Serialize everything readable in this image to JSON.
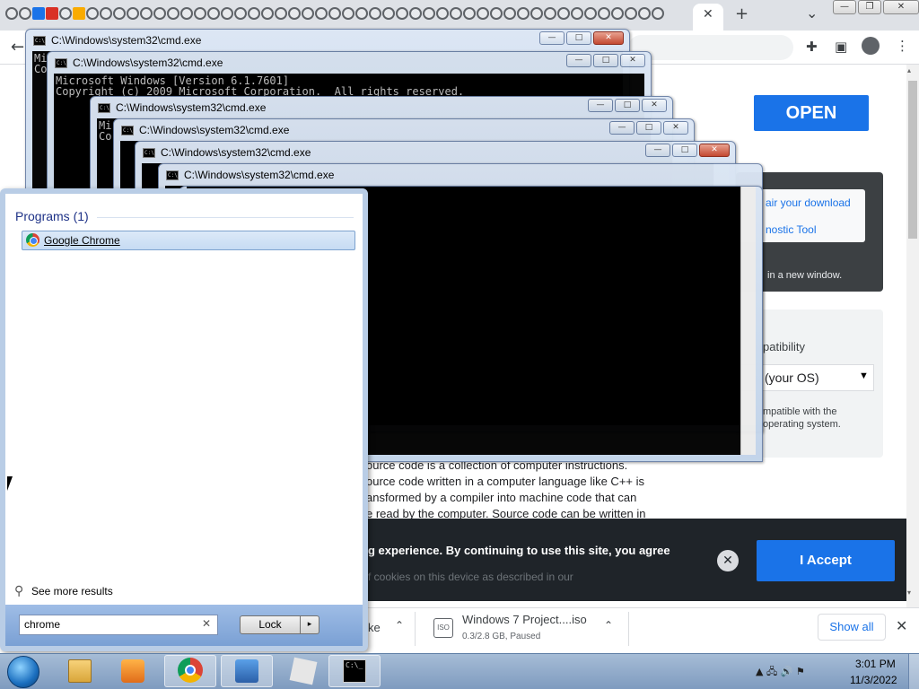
{
  "browser": {
    "new_tab_glyph": "+",
    "close_tab_glyph": "✕",
    "menu_caret": "⌄",
    "back_glyph": "←",
    "window_controls": [
      "—",
      "❐",
      "✕"
    ],
    "toolbar_icons": [
      "extensions-icon",
      "side-panel-icon",
      "profile-icon",
      "menu-icon"
    ]
  },
  "page": {
    "open_button": "OPEN",
    "repair_link": "air your download",
    "diagnostic_link": "nostic Tool",
    "new_window_text": "in a new window.",
    "compat_label": "patibility",
    "os_select_value": "(your OS)",
    "compat_note_1": "mpatible with the",
    "compat_note_2": "operating system.",
    "body_lines": [
      "ource code is a collection of computer instructions.",
      "ource code written in a computer language like C++ is",
      "ansformed by a compiler into machine code that can",
      "e read by the computer. Source code can be written in"
    ]
  },
  "cookie": {
    "text": "g experience. By continuing to use this site, you agree",
    "sub": "f cookies on this device as described in our",
    "close_glyph": "✕",
    "accept_label": "I Accept"
  },
  "downloads": {
    "prev_name": "ke",
    "item_name": "Windows 7 Project....iso",
    "item_status": "0.3/2.8 GB, Paused",
    "item_icon": "ISO",
    "show_all": "Show all",
    "close_glyph": "✕",
    "chevron": "⌃"
  },
  "cmd": {
    "title": "C:\\Windows\\system32\\cmd.exe",
    "icon_text": "C:\\",
    "line1": "Microsoft Windows [Version 6.1.7601]",
    "line2": "Copyright (c) 2009 Microsoft Corporation.  All rights reserved.",
    "behind_chars": "Mi\nCo",
    "min_glyph": "—",
    "max_glyph": "□",
    "close_glyph": "✕",
    "scroll_down": "▾",
    "scroll_up": "▴"
  },
  "start_menu": {
    "heading": "Programs (1)",
    "result": "Google Chrome",
    "see_more": "See more results",
    "search_value": "chrome",
    "search_clear": "✕",
    "lock_label": "Lock",
    "lock_arrow": "▸",
    "more_icon": "⚲"
  },
  "taskbar": {
    "cmd_icon_text": "C:\\_",
    "tray_icons": "▲ 🖧 🔊 ⚑",
    "time": "3:01 PM",
    "date": "11/3/2022"
  }
}
